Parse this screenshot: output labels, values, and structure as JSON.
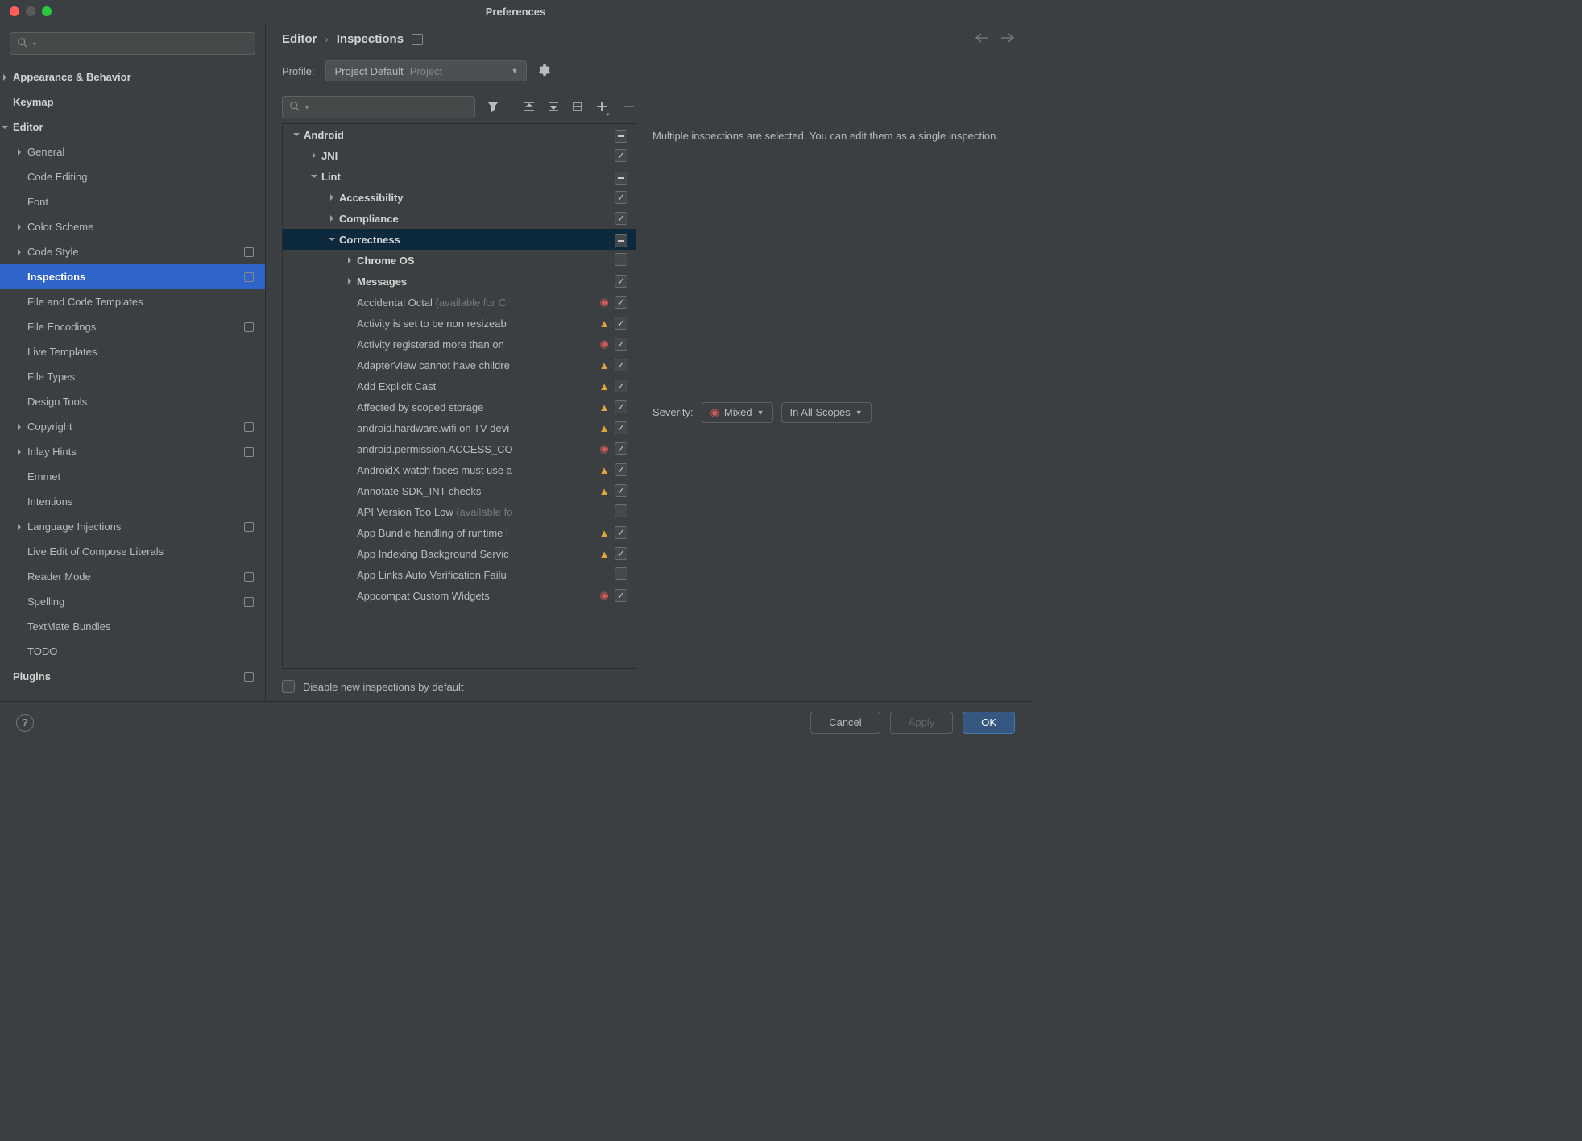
{
  "window": {
    "title": "Preferences"
  },
  "breadcrumb": {
    "root": "Editor",
    "leaf": "Inspections"
  },
  "profile": {
    "label": "Profile:",
    "selected": "Project Default",
    "scope_tag": "Project"
  },
  "sidebar": {
    "items": [
      {
        "label": "Appearance & Behavior",
        "bold": true,
        "arrow": "right",
        "level": 0
      },
      {
        "label": "Keymap",
        "bold": true,
        "level": 0
      },
      {
        "label": "Editor",
        "bold": true,
        "arrow": "down",
        "level": 0
      },
      {
        "label": "General",
        "arrow": "right",
        "level": 1
      },
      {
        "label": "Code Editing",
        "level": 1
      },
      {
        "label": "Font",
        "level": 1
      },
      {
        "label": "Color Scheme",
        "arrow": "right",
        "level": 1
      },
      {
        "label": "Code Style",
        "arrow": "right",
        "level": 1,
        "badge": true
      },
      {
        "label": "Inspections",
        "level": 1,
        "selected": true,
        "badge": true
      },
      {
        "label": "File and Code Templates",
        "level": 1
      },
      {
        "label": "File Encodings",
        "level": 1,
        "badge": true
      },
      {
        "label": "Live Templates",
        "level": 1
      },
      {
        "label": "File Types",
        "level": 1
      },
      {
        "label": "Design Tools",
        "level": 1
      },
      {
        "label": "Copyright",
        "arrow": "right",
        "level": 1,
        "badge": true
      },
      {
        "label": "Inlay Hints",
        "arrow": "right",
        "level": 1,
        "badge": true
      },
      {
        "label": "Emmet",
        "level": 1
      },
      {
        "label": "Intentions",
        "level": 1
      },
      {
        "label": "Language Injections",
        "arrow": "right",
        "level": 1,
        "badge": true
      },
      {
        "label": "Live Edit of Compose Literals",
        "level": 1
      },
      {
        "label": "Reader Mode",
        "level": 1,
        "badge": true
      },
      {
        "label": "Spelling",
        "level": 1,
        "badge": true
      },
      {
        "label": "TextMate Bundles",
        "level": 1
      },
      {
        "label": "TODO",
        "level": 1
      },
      {
        "label": "Plugins",
        "bold": true,
        "level": 0,
        "badge": true
      }
    ]
  },
  "inspections_tree": [
    {
      "indent": 0,
      "arrow": "down",
      "label": "Android",
      "bold": true,
      "check": "mixed"
    },
    {
      "indent": 1,
      "arrow": "right",
      "label": "JNI",
      "bold": true,
      "check": "checked"
    },
    {
      "indent": 1,
      "arrow": "down",
      "label": "Lint",
      "bold": true,
      "check": "mixed"
    },
    {
      "indent": 2,
      "arrow": "right",
      "label": "Accessibility",
      "bold": true,
      "check": "checked"
    },
    {
      "indent": 2,
      "arrow": "right",
      "label": "Compliance",
      "bold": true,
      "check": "checked"
    },
    {
      "indent": 2,
      "arrow": "down",
      "label": "Correctness",
      "bold": true,
      "check": "mixed",
      "selected": true
    },
    {
      "indent": 3,
      "arrow": "right",
      "label": "Chrome OS",
      "bold": true,
      "check": "off"
    },
    {
      "indent": 3,
      "arrow": "right",
      "label": "Messages",
      "bold": true,
      "check": "checked"
    },
    {
      "indent": 3,
      "label": "Accidental Octal",
      "hint": " (available for C",
      "sev": "err",
      "check": "checked"
    },
    {
      "indent": 3,
      "label": "Activity is set to be non resizeab",
      "sev": "warn",
      "check": "checked"
    },
    {
      "indent": 3,
      "label": "Activity registered more than on",
      "sev": "err",
      "check": "checked"
    },
    {
      "indent": 3,
      "label": "AdapterView cannot have childre",
      "sev": "warn",
      "check": "checked"
    },
    {
      "indent": 3,
      "label": "Add Explicit Cast",
      "sev": "warn",
      "check": "checked"
    },
    {
      "indent": 3,
      "label": "Affected by scoped storage",
      "sev": "warn",
      "check": "checked"
    },
    {
      "indent": 3,
      "label": "android.hardware.wifi on TV devi",
      "sev": "warn",
      "check": "checked"
    },
    {
      "indent": 3,
      "label": "android.permission.ACCESS_CO",
      "sev": "err",
      "check": "checked"
    },
    {
      "indent": 3,
      "label": "AndroidX watch faces must use a",
      "sev": "warn",
      "check": "checked"
    },
    {
      "indent": 3,
      "label": "Annotate SDK_INT checks",
      "sev": "warn",
      "check": "checked"
    },
    {
      "indent": 3,
      "label": "API Version Too Low",
      "hint": " (available fo",
      "check": "off"
    },
    {
      "indent": 3,
      "label": "App Bundle handling of runtime l",
      "sev": "warn",
      "check": "checked"
    },
    {
      "indent": 3,
      "label": "App Indexing Background Servic",
      "sev": "warn",
      "check": "checked"
    },
    {
      "indent": 3,
      "label": "App Links Auto Verification Failu",
      "check": "off"
    },
    {
      "indent": 3,
      "label": "Appcompat Custom Widgets",
      "sev": "err",
      "check": "checked"
    }
  ],
  "detail": {
    "text": "Multiple inspections are selected. You can edit them as a single inspection.",
    "severity_label": "Severity:",
    "severity_value": "Mixed",
    "scope_value": "In All Scopes"
  },
  "disable_new": {
    "label": "Disable new inspections by default"
  },
  "footer": {
    "cancel": "Cancel",
    "apply": "Apply",
    "ok": "OK"
  }
}
